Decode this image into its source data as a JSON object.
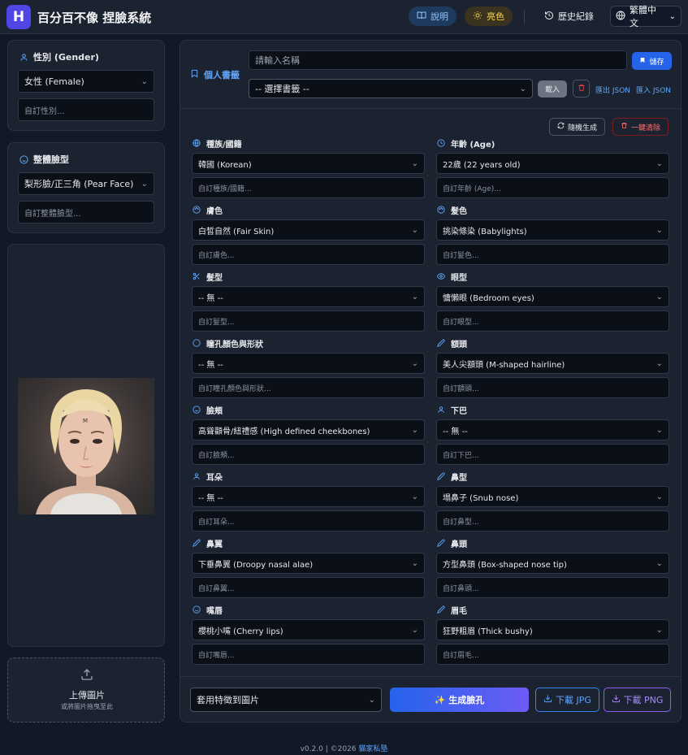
{
  "app": {
    "logo_letter": "H",
    "title": "百分百不像 捏臉系統"
  },
  "header": {
    "help": "說明",
    "theme": "亮色",
    "history": "歷史紀錄",
    "language": "繁體中文"
  },
  "left": {
    "gender": {
      "label": "性別 (Gender)",
      "value": "女性 (Female)",
      "placeholder": "自訂性別..."
    },
    "face": {
      "label": "整體臉型",
      "value": "梨形臉/正三角 (Pear Face)",
      "placeholder": "自訂整體臉型..."
    },
    "upload": {
      "label": "上傳圖片",
      "hint": "或將圖片拖曳至此"
    }
  },
  "bookmarks": {
    "label": "個人書籤",
    "name_placeholder": "請輸入名稱",
    "save": "儲存",
    "select": "-- 選擇書籤 --",
    "load": "載入",
    "export": "匯出 JSON",
    "import": "匯入 JSON"
  },
  "actions": {
    "random": "隨機生成",
    "clear": "一鍵清除"
  },
  "fields": [
    {
      "label": "種族/國籍",
      "value": "韓國 (Korean)",
      "placeholder": "自訂種族/國籍..."
    },
    {
      "label": "年齡 (Age)",
      "value": "22歲 (22 years old)",
      "placeholder": "自訂年齡 (Age)..."
    },
    {
      "label": "膚色",
      "value": "白皙自然 (Fair Skin)",
      "placeholder": "自訂膚色..."
    },
    {
      "label": "髮色",
      "value": "挑染條染 (Babylights)",
      "placeholder": "自訂髮色..."
    },
    {
      "label": "髮型",
      "value": "-- 無 --",
      "placeholder": "自訂髮型..."
    },
    {
      "label": "眼型",
      "value": "慵懶眼 (Bedroom eyes)",
      "placeholder": "自訂眼型..."
    },
    {
      "label": "瞳孔顏色與形狀",
      "value": "-- 無 --",
      "placeholder": "自訂瞳孔顏色與形狀..."
    },
    {
      "label": "額頭",
      "value": "美人尖額頭 (M-shaped hairline)",
      "placeholder": "自訂額頭..."
    },
    {
      "label": "臉頰",
      "value": "高聳顴骨/紐禮感 (High defined cheekbones)",
      "placeholder": "自訂臉頰..."
    },
    {
      "label": "下巴",
      "value": "-- 無 --",
      "placeholder": "自訂下巴..."
    },
    {
      "label": "耳朵",
      "value": "-- 無 --",
      "placeholder": "自訂耳朵..."
    },
    {
      "label": "鼻型",
      "value": "塌鼻子 (Snub nose)",
      "placeholder": "自訂鼻型..."
    },
    {
      "label": "鼻翼",
      "value": "下垂鼻翼 (Droopy nasal alae)",
      "placeholder": "自訂鼻翼..."
    },
    {
      "label": "鼻頭",
      "value": "方型鼻頭 (Box-shaped nose tip)",
      "placeholder": "自訂鼻頭..."
    },
    {
      "label": "嘴唇",
      "value": "櫻桃小嘴 (Cherry lips)",
      "placeholder": "自訂嘴唇..."
    },
    {
      "label": "眉毛",
      "value": "狂野粗眉 (Thick bushy)",
      "placeholder": "自訂眉毛..."
    }
  ],
  "field_icons": [
    "globe-icon",
    "clock-icon",
    "palette-icon",
    "palette-icon",
    "scissors-icon",
    "eye-icon",
    "circle-icon",
    "pen-icon",
    "smile-icon",
    "user-icon",
    "user-icon",
    "pen-icon",
    "pen-icon",
    "pen-icon",
    "smile-icon",
    "pen-icon"
  ],
  "bottom": {
    "apply": "套用特徵到圖片",
    "generate": "✨ 生成臉孔",
    "jpg": "下載 JPG",
    "png": "下載 PNG"
  },
  "footer": {
    "version": "v0.2.0 | ©2026",
    "link": "貓家私塾"
  },
  "colors": {
    "accent": "#3b82f6",
    "danger": "#ef4444",
    "generate_gradient": [
      "#2563eb",
      "#6d5cf6"
    ]
  }
}
